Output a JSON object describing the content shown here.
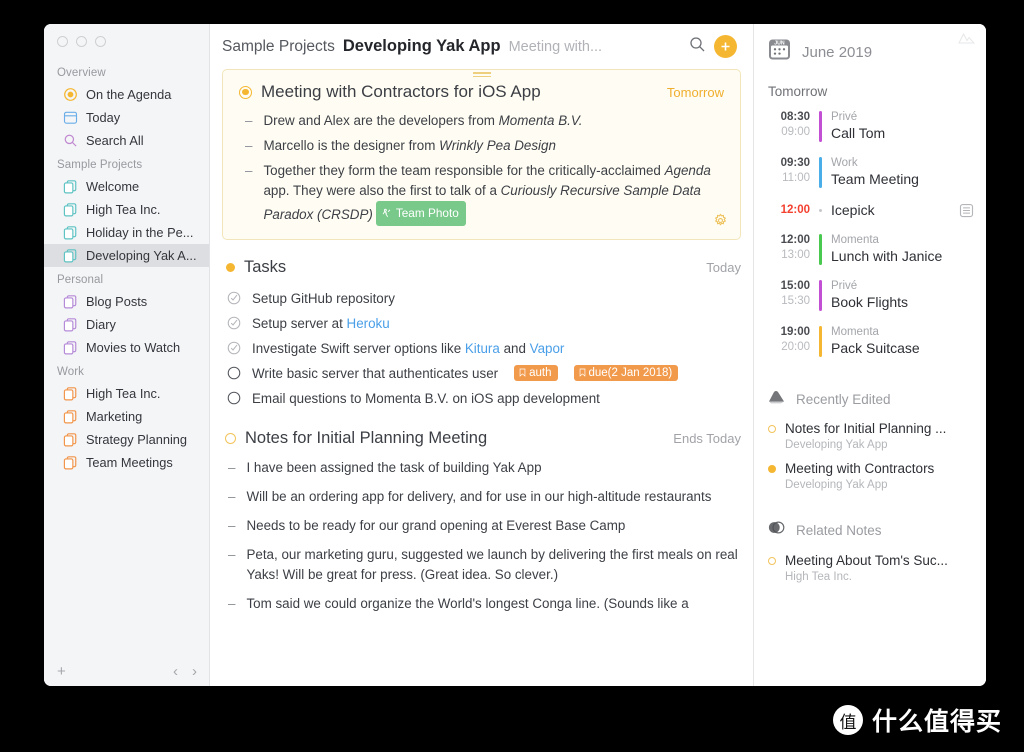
{
  "window": {
    "traffic_lights": [
      "close",
      "minimize",
      "zoom"
    ]
  },
  "sidebar": {
    "sections": [
      {
        "title": "Overview",
        "items": [
          {
            "label": "On the Agenda",
            "icon": "target-icon",
            "color": "#f5b731",
            "selected": false
          },
          {
            "label": "Today",
            "icon": "calendar-icon",
            "color": "#6aaee8",
            "selected": false
          },
          {
            "label": "Search All",
            "icon": "search-icon",
            "color": "#c088d0",
            "selected": false
          }
        ]
      },
      {
        "title": "Sample Projects",
        "items": [
          {
            "label": "Welcome",
            "icon": "documents-icon",
            "color": "#5ec3c3",
            "selected": false
          },
          {
            "label": "High Tea Inc.",
            "icon": "documents-icon",
            "color": "#5ec3c3",
            "selected": false
          },
          {
            "label": "Holiday in the Pe...",
            "icon": "documents-icon",
            "color": "#5ec3c3",
            "selected": false
          },
          {
            "label": "Developing Yak A...",
            "icon": "documents-icon",
            "color": "#5ec3c3",
            "selected": true
          }
        ]
      },
      {
        "title": "Personal",
        "items": [
          {
            "label": "Blog Posts",
            "icon": "documents-icon",
            "color": "#b58ad8",
            "selected": false
          },
          {
            "label": "Diary",
            "icon": "documents-icon",
            "color": "#b58ad8",
            "selected": false
          },
          {
            "label": "Movies to Watch",
            "icon": "documents-icon",
            "color": "#b58ad8",
            "selected": false
          }
        ]
      },
      {
        "title": "Work",
        "items": [
          {
            "label": "High Tea Inc.",
            "icon": "documents-icon",
            "color": "#f2954a",
            "selected": false
          },
          {
            "label": "Marketing",
            "icon": "documents-icon",
            "color": "#f2954a",
            "selected": false
          },
          {
            "label": "Strategy Planning",
            "icon": "documents-icon",
            "color": "#f2954a",
            "selected": false
          },
          {
            "label": "Team Meetings",
            "icon": "documents-icon",
            "color": "#f2954a",
            "selected": false
          }
        ]
      }
    ],
    "footer": {
      "add_label": "+",
      "back_label": "‹",
      "forward_label": "›"
    }
  },
  "topbar": {
    "breadcrumb_project": "Sample Projects",
    "breadcrumb_note": "Developing Yak App",
    "breadcrumb_item": "Meeting with...",
    "search_icon": "search-icon",
    "add_icon": "plus-icon",
    "accent": "#f5b731"
  },
  "meeting_card": {
    "title": "Meeting with Contractors for iOS App",
    "when": "Tomorrow",
    "status_icon": "filled-ring-icon",
    "gear_icon": "gear-icon",
    "bullets": [
      [
        {
          "t": "Drew and Alex are the developers from ",
          "i": false
        },
        {
          "t": "Momenta B.V.",
          "i": true
        }
      ],
      [
        {
          "t": "Marcello is the designer from ",
          "i": false
        },
        {
          "t": "Wrinkly Pea Design",
          "i": true
        }
      ],
      [
        {
          "t": "Together they form the team responsible for the critically-acclaimed ",
          "i": false
        },
        {
          "t": "Agenda",
          "i": true
        },
        {
          "t": " app. They were also the first to talk of a ",
          "i": false
        },
        {
          "t": "Curiously Recursive Sample Data Paradox (CRSDP)",
          "i": true
        }
      ]
    ],
    "tag": {
      "label": "Team Photo",
      "icon": "people-icon",
      "color": "#79c98a"
    }
  },
  "tasks_section": {
    "title": "Tasks",
    "when": "Today",
    "status_icon": "dot-icon",
    "items": [
      {
        "done": true,
        "parts": [
          {
            "t": "Setup GitHub repository",
            "link": false
          }
        ],
        "tags": []
      },
      {
        "done": true,
        "parts": [
          {
            "t": "Setup server at ",
            "link": false
          },
          {
            "t": "Heroku",
            "link": true
          }
        ],
        "tags": []
      },
      {
        "done": true,
        "parts": [
          {
            "t": "Investigate Swift server options like ",
            "link": false
          },
          {
            "t": "Kitura",
            "link": true
          },
          {
            "t": " and ",
            "link": false
          },
          {
            "t": "Vapor",
            "link": true
          }
        ],
        "tags": []
      },
      {
        "done": false,
        "parts": [
          {
            "t": "Write basic server that authenticates user",
            "link": false
          }
        ],
        "tags": [
          "auth",
          "due(2 Jan 2018)"
        ]
      },
      {
        "done": false,
        "parts": [
          {
            "t": "Email questions to Momenta B.V. on iOS app development",
            "link": false
          }
        ],
        "tags": []
      }
    ]
  },
  "notes_section": {
    "title": "Notes for Initial Planning Meeting",
    "when": "Ends Today",
    "status_icon": "open-ring-icon",
    "bullets": [
      "I have been assigned the task of building Yak App",
      "Will be an ordering app for delivery, and for use in our high-altitude restaurants",
      "Needs to be ready for our grand opening at Everest Base Camp",
      "Peta, our marketing guru, suggested we launch by delivering the first meals on real Yaks! Will be great for press. (Great idea. So clever.)",
      "Tom said we could organize the World's longest Conga line. (Sounds like a"
    ]
  },
  "right_panel": {
    "calendar_icon": "calendar-jun-icon",
    "calendar_icon_label": "JUN",
    "month": "June 2019",
    "day_label": "Tomorrow",
    "events": [
      {
        "start": "08:30",
        "end": "09:00",
        "calendar": "Privé",
        "title": "Call Tom",
        "color": "#c34fd4",
        "style": "range"
      },
      {
        "start": "09:30",
        "end": "11:00",
        "calendar": "Work",
        "title": "Team Meeting",
        "color": "#4aaee8",
        "style": "range"
      },
      {
        "start": "12:00",
        "end": "",
        "calendar": "",
        "title": "Icepick",
        "color": "#c6c8cc",
        "style": "single",
        "trailing_icon": "note-icon"
      },
      {
        "start": "12:00",
        "end": "13:00",
        "calendar": "Momenta",
        "title": "Lunch with Janice",
        "color": "#49c94f",
        "style": "range"
      },
      {
        "start": "15:00",
        "end": "15:30",
        "calendar": "Privé",
        "title": "Book Flights",
        "color": "#c34fd4",
        "style": "range"
      },
      {
        "start": "19:00",
        "end": "20:00",
        "calendar": "Momenta",
        "title": "Pack Suitcase",
        "color": "#f5b731",
        "style": "range"
      }
    ],
    "recently_edited": {
      "title": "Recently Edited",
      "icon": "eraser-icon",
      "items": [
        {
          "title": "Notes for Initial Planning ...",
          "sub": "Developing Yak App",
          "marker": "open"
        },
        {
          "title": "Meeting with Contractors",
          "sub": "Developing Yak App",
          "marker": "full"
        }
      ]
    },
    "related_notes": {
      "title": "Related Notes",
      "icon": "venn-icon",
      "items": [
        {
          "title": "Meeting About Tom's Suc...",
          "sub": "High Tea Inc.",
          "marker": "open"
        }
      ]
    },
    "corner_icon": "mountains-icon"
  },
  "watermark": {
    "badge": "值",
    "text": "什么值得买"
  }
}
